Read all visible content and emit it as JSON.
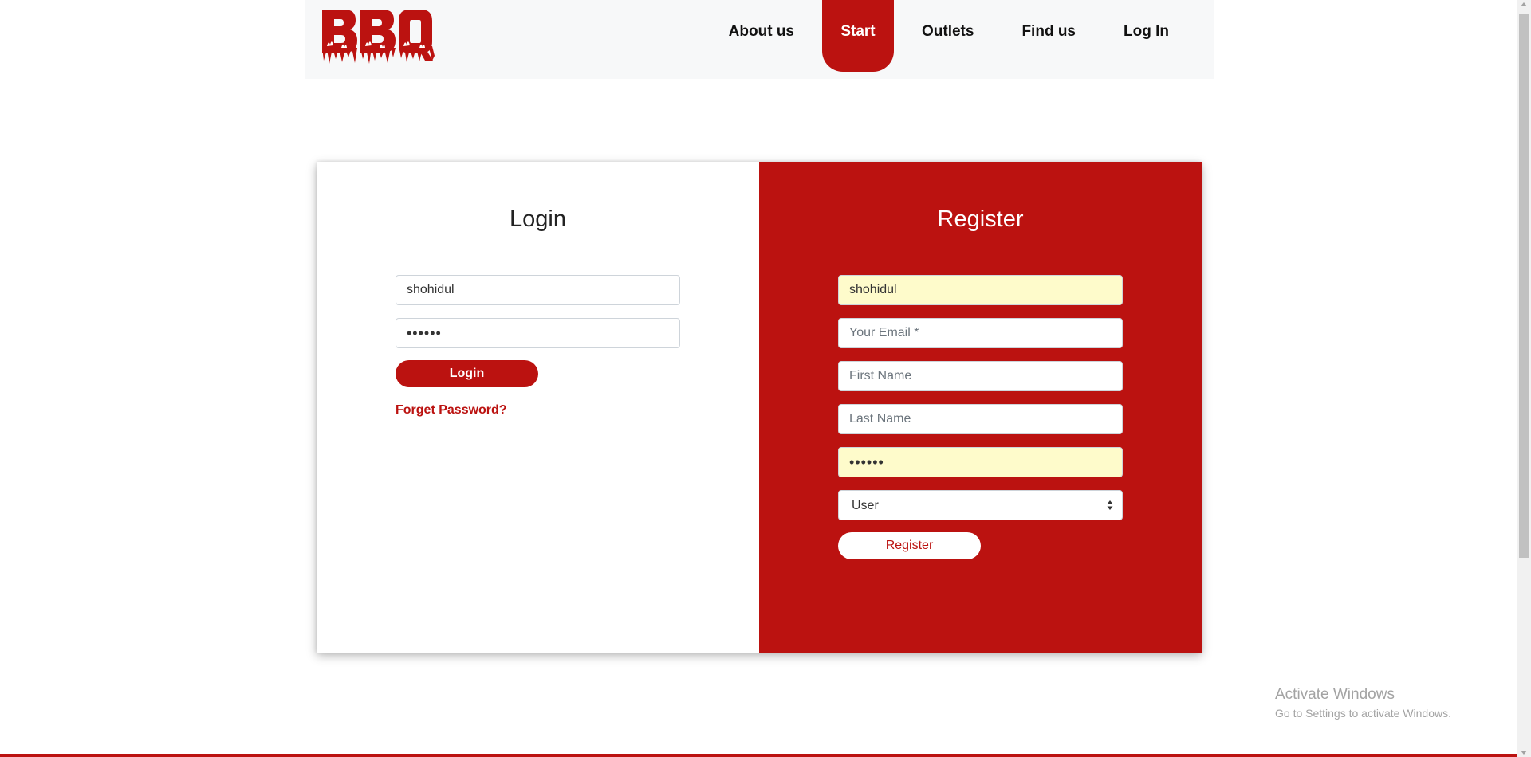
{
  "brand": {
    "logo_text": "BBQ",
    "accent_color": "#bb1210",
    "autofill_color": "#fefbcb"
  },
  "nav": {
    "items": [
      {
        "label": "About us",
        "active": false
      },
      {
        "label": "Start",
        "active": true
      },
      {
        "label": "Outlets",
        "active": false
      },
      {
        "label": "Find us",
        "active": false
      },
      {
        "label": "Log In",
        "active": false
      }
    ]
  },
  "login": {
    "title": "Login",
    "username_value": "shohidul",
    "password_value": "••••••",
    "button_label": "Login",
    "forgot_label": "Forget Password?"
  },
  "register": {
    "title": "Register",
    "username_value": "shohidul",
    "email_placeholder": "Your Email *",
    "first_name_placeholder": "First Name",
    "last_name_placeholder": "Last Name",
    "password_value": "••••••",
    "role_selected": "User",
    "button_label": "Register"
  },
  "watermark": {
    "title": "Activate Windows",
    "subtitle": "Go to Settings to activate Windows."
  },
  "icons": {
    "select_caret": "updown-caret-icon",
    "logo": "bbq-flame-logo"
  }
}
